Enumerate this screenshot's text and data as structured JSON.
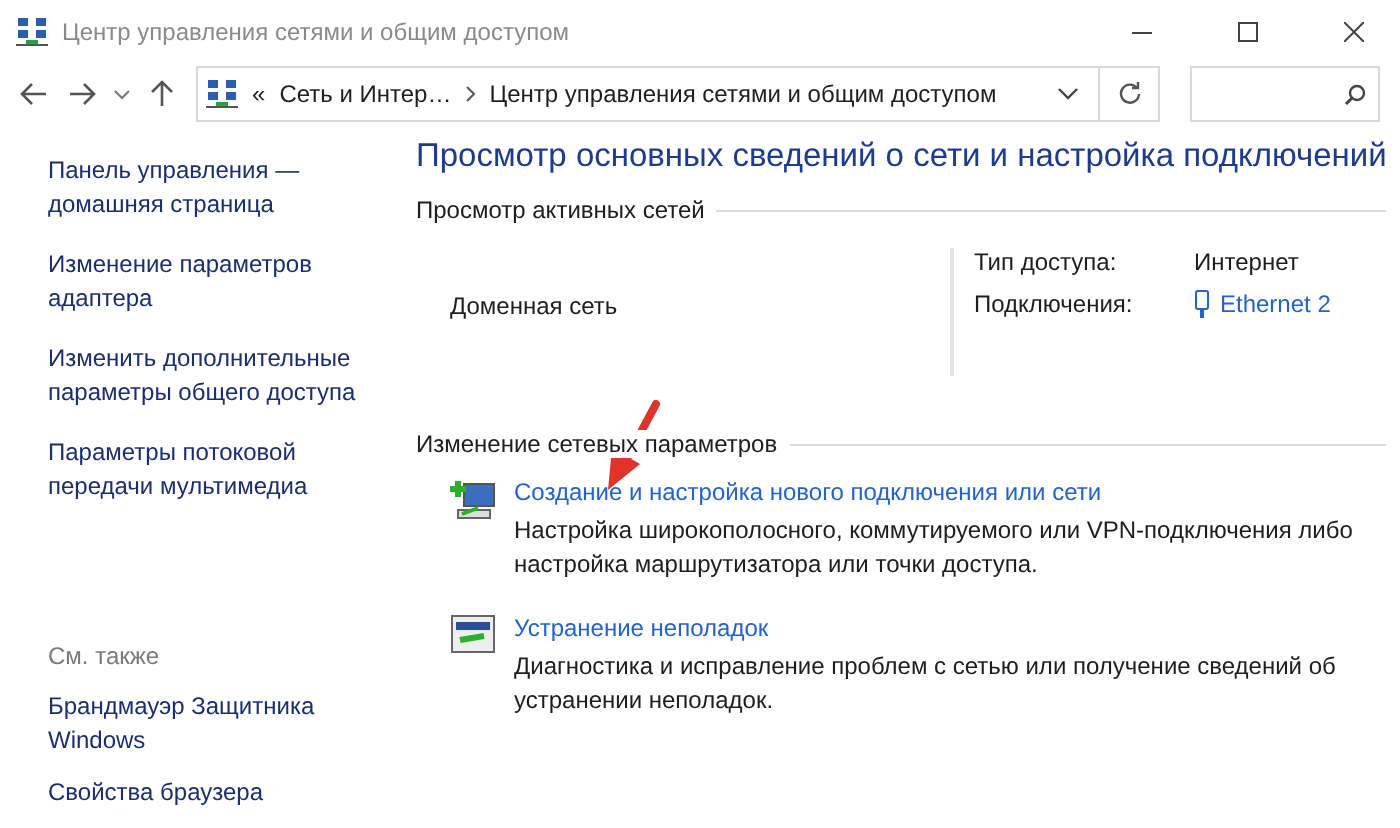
{
  "window": {
    "title": "Центр управления сетями и общим доступом"
  },
  "address_bar": {
    "overflow": "«",
    "breadcrumb": [
      "Сеть и Интер…",
      "Центр управления сетями и общим доступом"
    ]
  },
  "sidebar": {
    "links": [
      "Панель управления — домашняя страница",
      "Изменение параметров адаптера",
      "Изменить дополнительные параметры общего доступа",
      "Параметры потоковой передачи мультимедиа"
    ],
    "see_also_title": "См. также",
    "see_also_links": [
      "Брандмауэр Защитника Windows",
      "Свойства браузера"
    ]
  },
  "main": {
    "title": "Просмотр основных сведений о сети и настройка подключений",
    "active_networks": {
      "heading": "Просмотр активных сетей",
      "network_name": "Доменная сеть",
      "access_type_label": "Тип доступа:",
      "access_type": "Интернет",
      "connections_label": "Подключения:",
      "connection": "Ethernet 2"
    },
    "change_settings": {
      "heading": "Изменение сетевых параметров",
      "tasks": [
        {
          "kind": "new_connection",
          "link": "Создание и настройка нового подключения или сети",
          "description": "Настройка широкополосного, коммутируемого или VPN-подключения либо настройка маршрутизатора или точки доступа."
        },
        {
          "kind": "troubleshoot",
          "link": "Устранение неполадок",
          "description": "Диагностика и исправление проблем с сетью или получение сведений об устранении неполадок."
        }
      ]
    }
  }
}
